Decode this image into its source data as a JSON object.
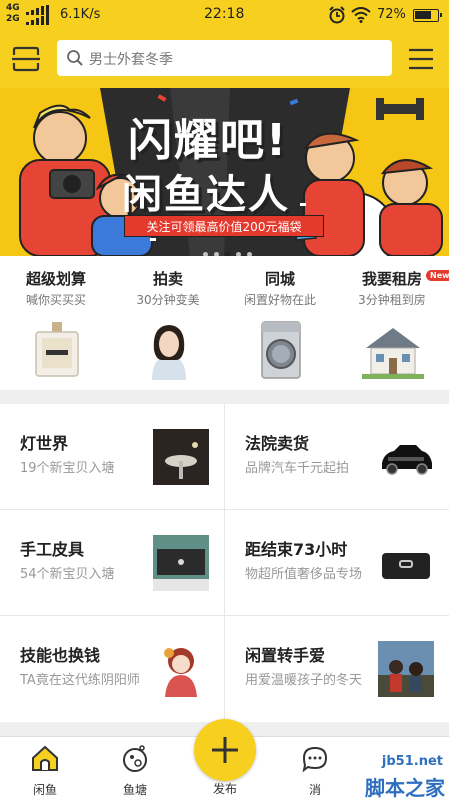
{
  "status_bar": {
    "network_top": "4G",
    "network_bottom": "2G",
    "speed": "6.1K/s",
    "time": "22:18",
    "battery": "72%"
  },
  "header": {
    "search_placeholder": "男士外套冬季"
  },
  "banner": {
    "title_line1": "闪耀吧!",
    "title_line2": "闲鱼达人",
    "ribbon": "关注可领最高价值200元福袋"
  },
  "categories": [
    {
      "title": "超级划算",
      "subtitle": "喊你买买买"
    },
    {
      "title": "拍卖",
      "subtitle": "30分钟变美"
    },
    {
      "title": "同城",
      "subtitle": "闲置好物在此"
    },
    {
      "title": "我要租房",
      "subtitle": "3分钟租到房",
      "badge": "New"
    }
  ],
  "grid": [
    {
      "title": "灯世界",
      "subtitle": "19个新宝贝入塘"
    },
    {
      "title": "法院卖货",
      "subtitle": "品牌汽车千元起拍"
    },
    {
      "title": "手工皮具",
      "subtitle": "54个新宝贝入塘"
    },
    {
      "title": "距结束73小时",
      "subtitle": "物超所值奢侈品专场"
    },
    {
      "title": "技能也换钱",
      "subtitle": "TA竟在这代练阴阳师"
    },
    {
      "title": "闲置转手爱",
      "subtitle": "用爱温暖孩子的冬天"
    }
  ],
  "tabbar": {
    "home": "闲鱼",
    "pond": "鱼塘",
    "publish": "发布",
    "messages": "消"
  },
  "watermark": {
    "url": "jb51.net",
    "name": "脚本之家"
  },
  "colors": {
    "brand_yellow": "#f6cf1f",
    "badge_red": "#e43a2e"
  }
}
